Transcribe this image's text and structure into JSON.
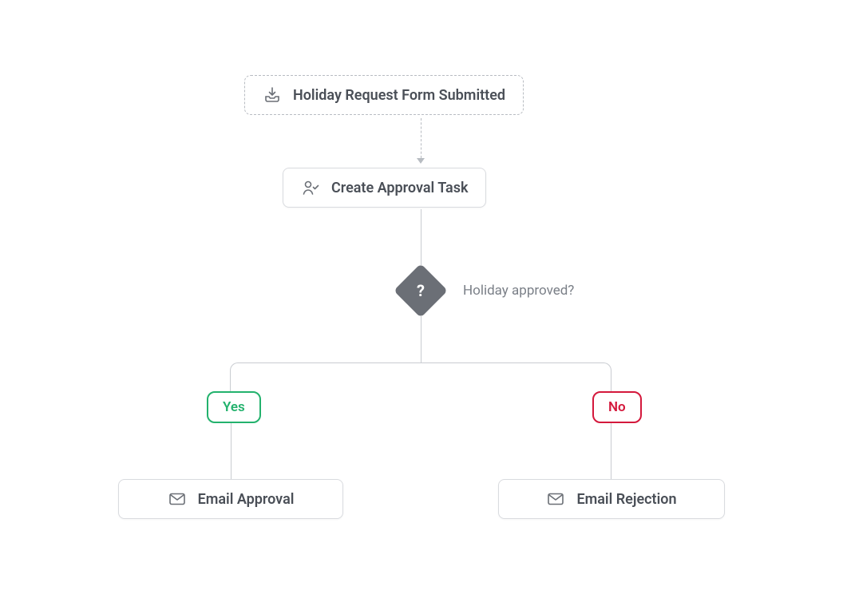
{
  "trigger": {
    "label": "Holiday Request Form Submitted"
  },
  "action_create": {
    "label": "Create Approval Task"
  },
  "decision": {
    "mark": "?",
    "label": "Holiday approved?"
  },
  "branches": {
    "yes": {
      "label": "Yes"
    },
    "no": {
      "label": "No"
    }
  },
  "email_approval": {
    "label": "Email Approval"
  },
  "email_rejection": {
    "label": "Email Rejection"
  },
  "colors": {
    "yes": "#23b26d",
    "no": "#d4183c",
    "node_text": "#4a4f57",
    "muted": "#7a7f87",
    "diamond": "#6b6f76"
  }
}
